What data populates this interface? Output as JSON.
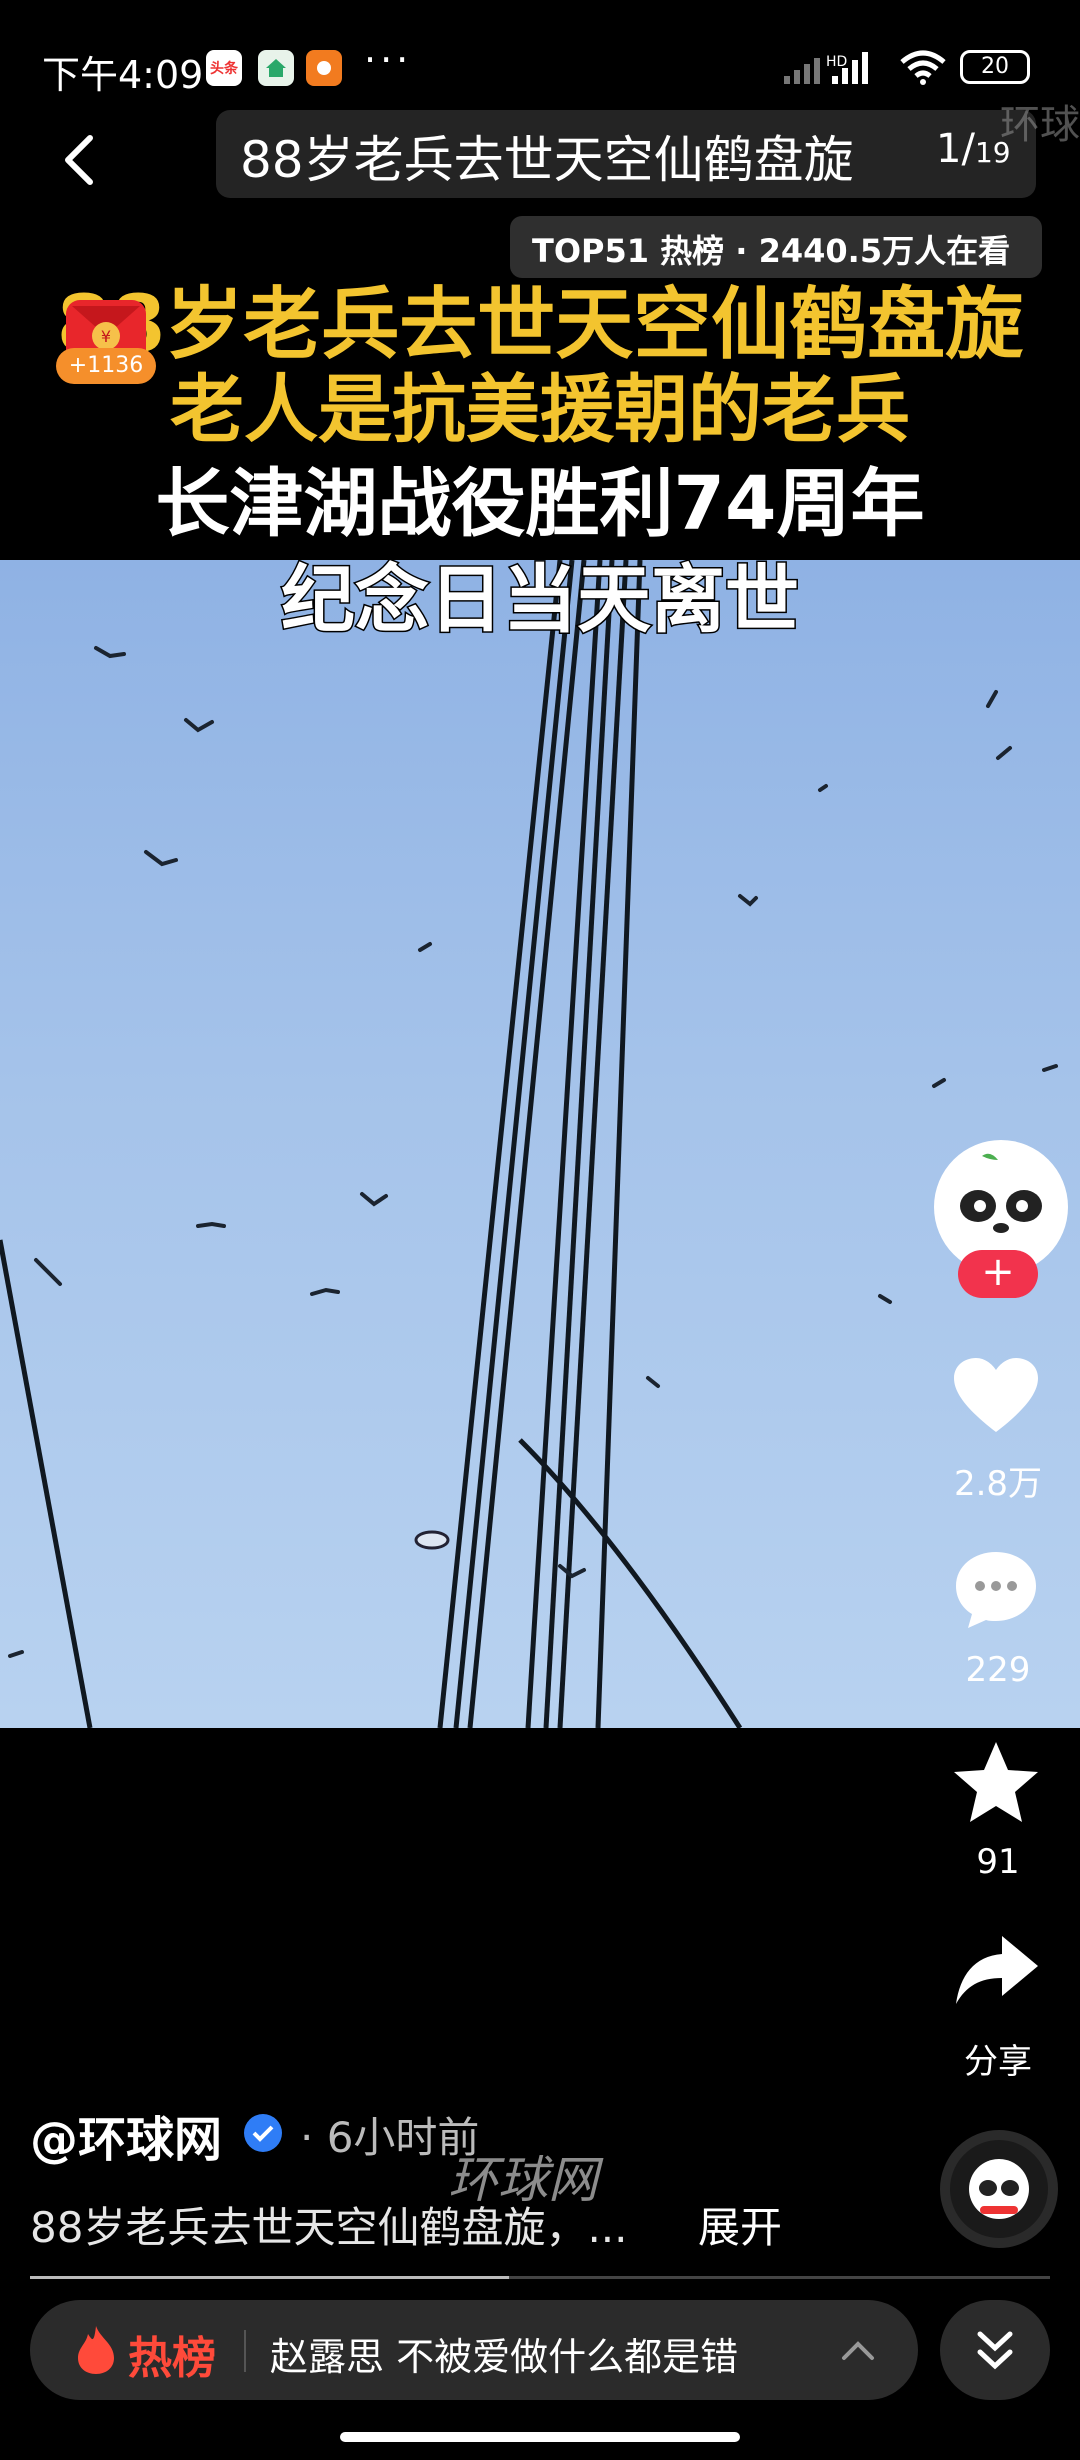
{
  "status_bar": {
    "time": "下午4:09",
    "app_chips": [
      "头条",
      "",
      ""
    ],
    "more": "···",
    "battery": "20"
  },
  "header": {
    "title": "88岁老兵去世天空仙鹤盘旋",
    "page_current": "1/",
    "page_total": "19",
    "watermark": "环球"
  },
  "hot_rank": {
    "text": "TOP51 热榜 · 2440.5万人在看"
  },
  "caption": {
    "line1": "88岁老兵去世天空仙鹤盘旋",
    "line2": "老人是抗美援朝的老兵",
    "line3": "长津湖战役胜利74周年",
    "line4": "纪念日当天离世"
  },
  "red_envelope": {
    "count": "+1136"
  },
  "actions": {
    "likes": "2.8万",
    "comments": "229",
    "favorites": "91",
    "share": "分享"
  },
  "post": {
    "author": "@环球网",
    "time": "· 6小时前",
    "watermark": "环球网",
    "description": "88岁老兵去世天空仙鹤盘旋，...",
    "expand": "展开",
    "progress": 0.47
  },
  "hot_bar": {
    "label": "热榜",
    "topic": "赵露思 不被爱做什么都是错"
  },
  "colors": {
    "caption_yellow": "#f3c42f",
    "accent_red": "#f2334d",
    "verified_blue": "#2f7df6"
  }
}
